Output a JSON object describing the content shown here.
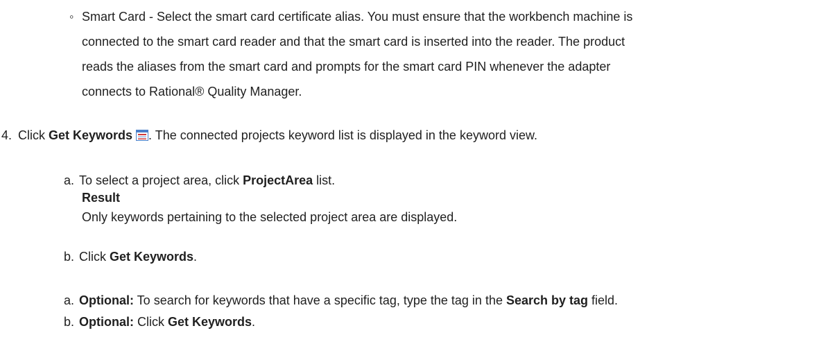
{
  "smart_card": {
    "bullet": "◦",
    "line1": "Smart Card - Select the smart card certificate alias. You must ensure that the workbench machine is",
    "line2": "connected to the smart card reader and that the smart card is inserted into the reader. The product",
    "line3": "reads the aliases from the smart card and prompts for the smart card PIN whenever the adapter",
    "line4": "connects to  Rational® Quality Manager."
  },
  "step4": {
    "number": "4.",
    "prefix": "Click ",
    "bold": "Get Keywords",
    "icon": "keyword-view-icon",
    "suffix": ". The connected projects keyword list is displayed in the keyword view."
  },
  "sub_a1": {
    "letter": "a.",
    "prefix": "To select a project area, click ",
    "bold": "ProjectArea",
    "suffix": " list."
  },
  "result": {
    "heading": "Result",
    "text": "Only keywords pertaining to the selected project area are displayed."
  },
  "sub_b1": {
    "letter": "b.",
    "prefix": "Click ",
    "bold": "Get Keywords",
    "suffix": "."
  },
  "sub_a2": {
    "letter": "a.",
    "optional": "Optional:",
    "prefix": " To search for keywords that have a specific tag, type the tag in the ",
    "bold": "Search by tag",
    "suffix": "  field."
  },
  "sub_b2": {
    "letter": "b.",
    "optional": "Optional:",
    "prefix": " Click ",
    "bold": "Get Keywords",
    "suffix": "."
  },
  "colors": {
    "text": "#1f1f1f",
    "icon_blue": "#4a7fc9",
    "icon_red": "#d23a3a"
  }
}
